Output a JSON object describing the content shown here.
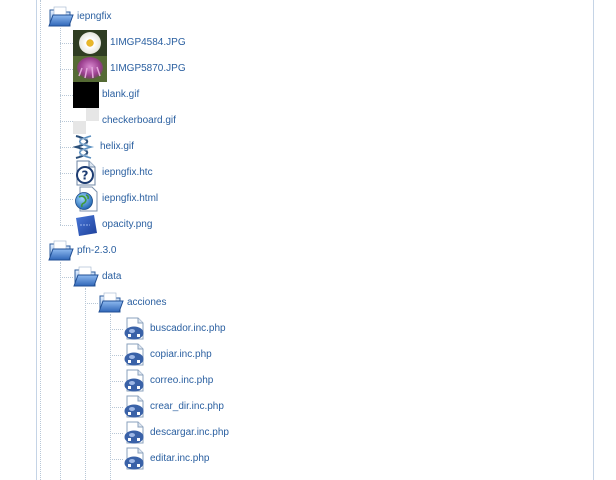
{
  "file_tree": {
    "items": [
      {
        "depth": 1,
        "type": "folder",
        "label": "iepngfix",
        "icon": "folder-open-icon"
      },
      {
        "depth": 2,
        "type": "file",
        "label": "1IMGP4584.JPG",
        "icon": "image-thumbnail-white-flower"
      },
      {
        "depth": 2,
        "type": "file",
        "label": "1IMGP5870.JPG",
        "icon": "image-thumbnail-purple-flower"
      },
      {
        "depth": 2,
        "type": "file",
        "label": "blank.gif",
        "icon": "image-thumbnail-black"
      },
      {
        "depth": 2,
        "type": "file",
        "label": "checkerboard.gif",
        "icon": "image-thumbnail-checkerboard"
      },
      {
        "depth": 2,
        "type": "file",
        "label": "helix.gif",
        "icon": "image-thumbnail-helix"
      },
      {
        "depth": 2,
        "type": "file",
        "label": "iepngfix.htc",
        "icon": "unknown-file-icon"
      },
      {
        "depth": 2,
        "type": "file",
        "label": "iepngfix.html",
        "icon": "html-globe-icon"
      },
      {
        "depth": 2,
        "type": "file",
        "label": "opacity.png",
        "icon": "image-thumbnail-blue"
      },
      {
        "depth": 1,
        "type": "folder",
        "label": "pfn-2.3.0",
        "icon": "folder-open-icon"
      },
      {
        "depth": 2,
        "type": "folder",
        "label": "data",
        "icon": "folder-open-icon"
      },
      {
        "depth": 3,
        "type": "folder",
        "label": "acciones",
        "icon": "folder-open-icon"
      },
      {
        "depth": 4,
        "type": "file",
        "label": "buscador.inc.php",
        "icon": "php-file-icon"
      },
      {
        "depth": 4,
        "type": "file",
        "label": "copiar.inc.php",
        "icon": "php-file-icon"
      },
      {
        "depth": 4,
        "type": "file",
        "label": "correo.inc.php",
        "icon": "php-file-icon"
      },
      {
        "depth": 4,
        "type": "file",
        "label": "crear_dir.inc.php",
        "icon": "php-file-icon"
      },
      {
        "depth": 4,
        "type": "file",
        "label": "descargar.inc.php",
        "icon": "php-file-icon"
      },
      {
        "depth": 4,
        "type": "file",
        "label": "editar.inc.php",
        "icon": "php-file-icon"
      }
    ]
  },
  "colors": {
    "link": "#2a5fa0",
    "guide_line": "#b8c7d6",
    "side_border": "#c5d4e6",
    "folder_blue": "#3d78c4",
    "php_blue": "#3a62a8"
  }
}
